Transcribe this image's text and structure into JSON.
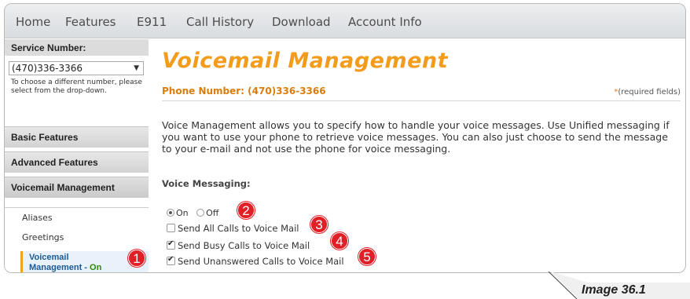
{
  "nav": {
    "items": [
      "Home",
      "Features",
      "E911",
      "Call History",
      "Download",
      "Account Info"
    ]
  },
  "sidebar": {
    "service_label": "Service Number:",
    "service_selected": "(470)336-3366",
    "hint": "To choose a different number, please select from the drop-down.",
    "sections": [
      "Basic Features",
      "Advanced Features",
      "Voicemail Management"
    ],
    "sub_items": [
      "Aliases",
      "Greetings"
    ],
    "current": {
      "line1": "Voicemail",
      "line2": "Management - ",
      "state": "On"
    }
  },
  "main": {
    "title": "Voicemail Management",
    "phone_number": "Phone Number: (470)336-3366",
    "required_star": "*",
    "required_note": "(required fields)",
    "description": "Voice Management allows you to specify how to handle your voice messages. Use Unified messaging if you want to use your phone to retrieve voice messages. You can also just choose to send the message to your e-mail and not use the phone for voice messaging.",
    "voice_messaging_label": "Voice Messaging:",
    "radio_on": "On",
    "radio_off": "Off",
    "voice_messaging_value": "On",
    "options": [
      {
        "label": "Send All Calls to Voice Mail",
        "checked": false
      },
      {
        "label": "Send Busy Calls to Voice Mail",
        "checked": true
      },
      {
        "label": "Send Unanswered Calls to Voice Mail",
        "checked": true
      }
    ]
  },
  "callouts": [
    "1",
    "2",
    "3",
    "4",
    "5"
  ],
  "caption": "Image 36.1",
  "colors": {
    "title_orange": "#f39c1b",
    "phone_orange": "#d97e0e",
    "callout_red": "#e11f26",
    "link_blue": "#1b5a96",
    "on_green": "#2f8a00"
  }
}
